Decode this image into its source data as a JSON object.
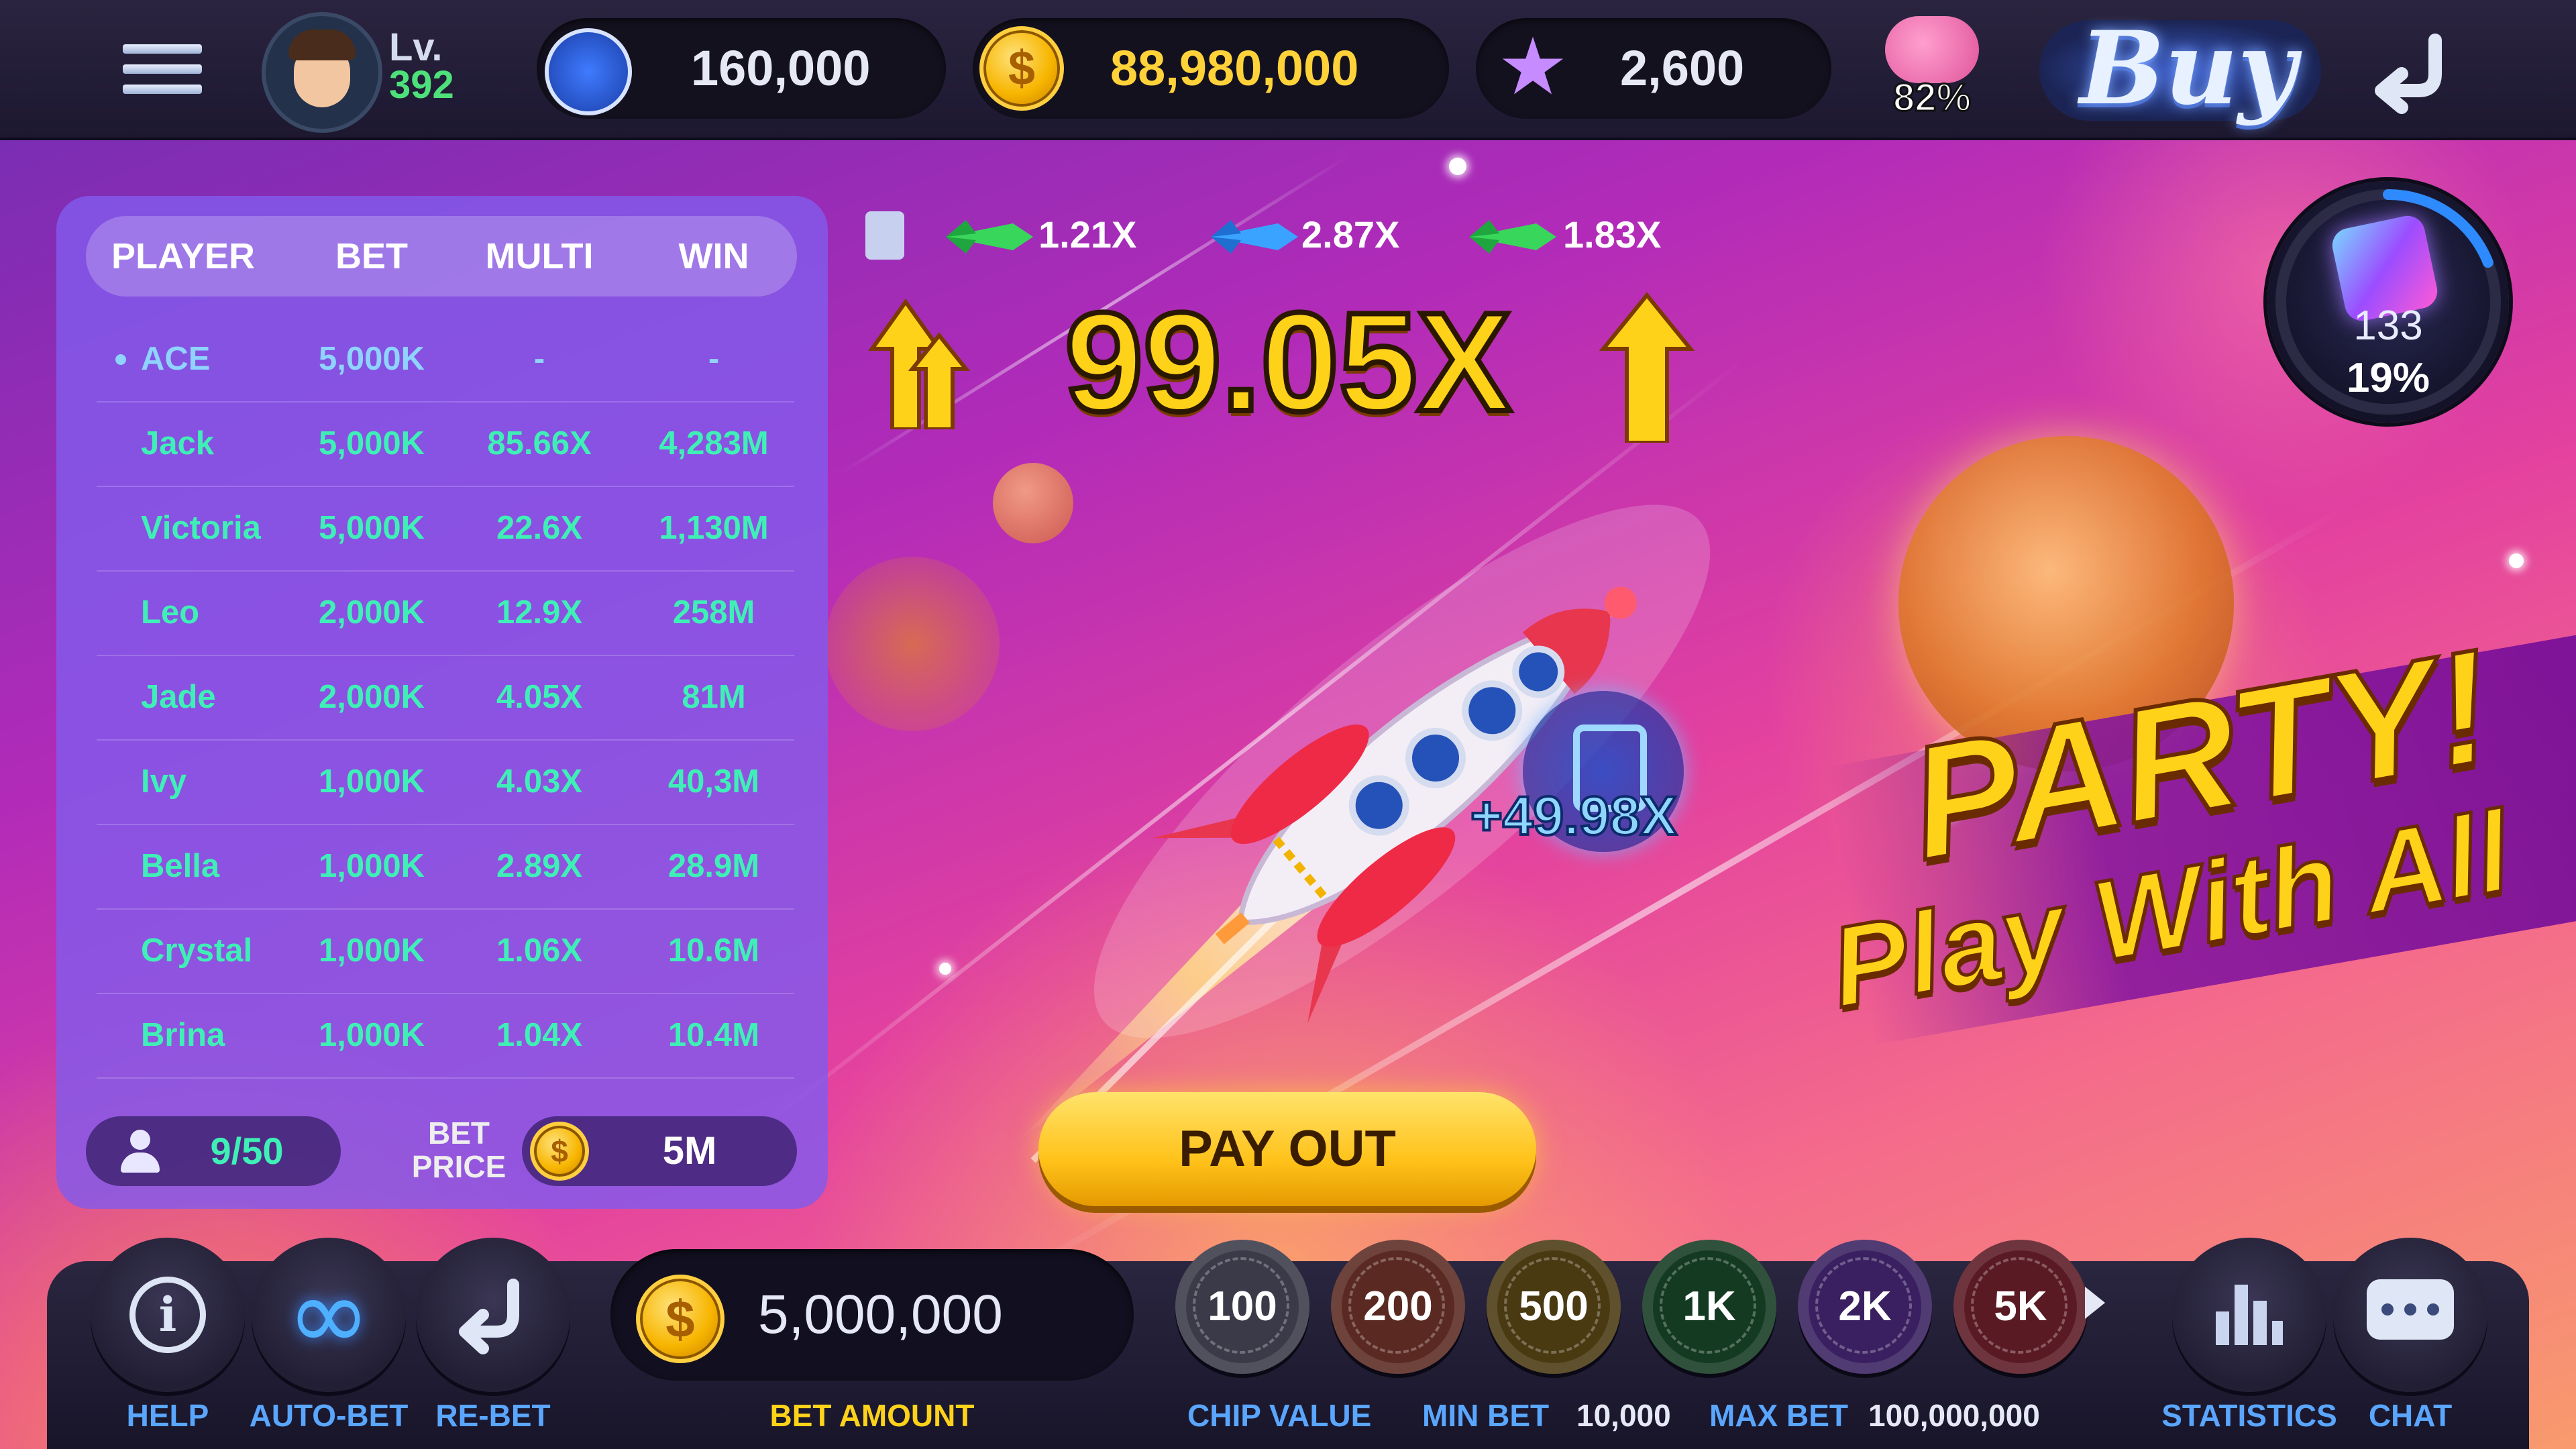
{
  "topbar": {
    "level_label": "Lv.",
    "level_value": "392",
    "rocket_balance": "160,000",
    "coin_balance": "88,980,000",
    "star_balance": "2,600",
    "piggy_percent": "82%",
    "buy_label": "Buy"
  },
  "board": {
    "headers": [
      "PLAYER",
      "BET",
      "MULTI",
      "WIN"
    ],
    "rows": [
      {
        "name": "ACE",
        "bet": "5,000K",
        "multi": "-",
        "win": "-"
      },
      {
        "name": "Jack",
        "bet": "5,000K",
        "multi": "85.66X",
        "win": "4,283M"
      },
      {
        "name": "Victoria",
        "bet": "5,000K",
        "multi": "22.6X",
        "win": "1,130M"
      },
      {
        "name": "Leo",
        "bet": "2,000K",
        "multi": "12.9X",
        "win": "258M"
      },
      {
        "name": "Jade",
        "bet": "2,000K",
        "multi": "4.05X",
        "win": "81M"
      },
      {
        "name": "Ivy",
        "bet": "1,000K",
        "multi": "4.03X",
        "win": "40,3M"
      },
      {
        "name": "Bella",
        "bet": "1,000K",
        "multi": "2.89X",
        "win": "28.9M"
      },
      {
        "name": "Crystal",
        "bet": "1,000K",
        "multi": "1.06X",
        "win": "10.6M"
      },
      {
        "name": "Brina",
        "bet": "1,000K",
        "multi": "1.04X",
        "win": "10.4M"
      }
    ],
    "players_count": "9/50",
    "bet_price_label": "BET PRICE",
    "bet_price_value": "5M"
  },
  "game": {
    "history": [
      "1.21X",
      "2.87X",
      "1.83X"
    ],
    "multiplier": "99.05X",
    "boost": "+49.98X",
    "payout_label": "PAY OUT",
    "party_line1": "PARTY!",
    "party_line2": "Play With All",
    "jackpot_count": "133",
    "jackpot_percent": "19%",
    "jackpot_progress": 0.19
  },
  "bottom": {
    "help_label": "HELP",
    "autobet_label": "AUTO-BET",
    "rebet_label": "RE-BET",
    "bet_amount": "5,000,000",
    "bet_amount_label": "BET AMOUNT",
    "chips": [
      "100",
      "200",
      "500",
      "1K",
      "2K",
      "5K"
    ],
    "chip_value_label": "CHIP VALUE",
    "min_bet_label": "MIN BET",
    "min_bet_value": "10,000",
    "max_bet_label": "MAX BET",
    "max_bet_value": "100,000,000",
    "statistics_label": "STATISTICS",
    "chat_label": "CHAT"
  },
  "colors": {
    "accent_gold": "#ffd21a",
    "win_green": "#3ff0b6",
    "label_blue": "#5aa6ff",
    "level_green": "#4ee07a"
  }
}
